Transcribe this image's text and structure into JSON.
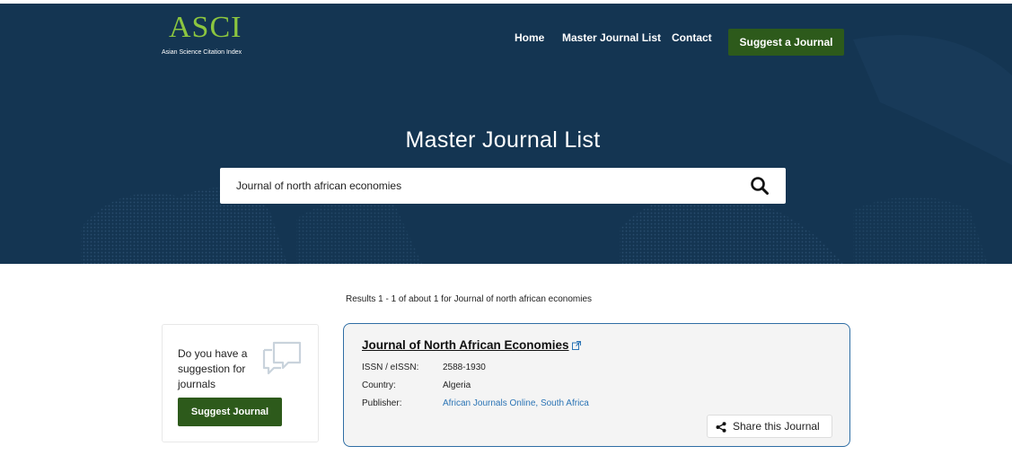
{
  "header": {
    "logo_mark": "ASCI",
    "logo_sub": "Asian Science Citation Index",
    "nav": [
      "Home",
      "Master Journal List",
      "Contact"
    ],
    "suggest_button": "Suggest a Journal"
  },
  "hero": {
    "title": "Master Journal List",
    "search_value": "Journal of north african economies"
  },
  "results_summary": "Results 1 - 1 of about 1 for Journal of north african economies",
  "sidebar": {
    "prompt": "Do you have a suggestion for journals",
    "button": "Suggest Journal"
  },
  "result": {
    "title": "Journal of North African Economies",
    "issn_label": "ISSN / eISSN:",
    "issn_value": "2588-1930",
    "country_label": "Country:",
    "country_value": "Algeria",
    "publisher_label": "Publisher:",
    "publisher_value": "African Journals Online, South Africa",
    "share_label": "Share this Journal"
  },
  "colors": {
    "hero_bg": "#143552",
    "accent_green": "#2d5a1b",
    "logo_green": "#8cc63f",
    "link_blue": "#2b74b5",
    "card_border": "#2e6da4"
  }
}
